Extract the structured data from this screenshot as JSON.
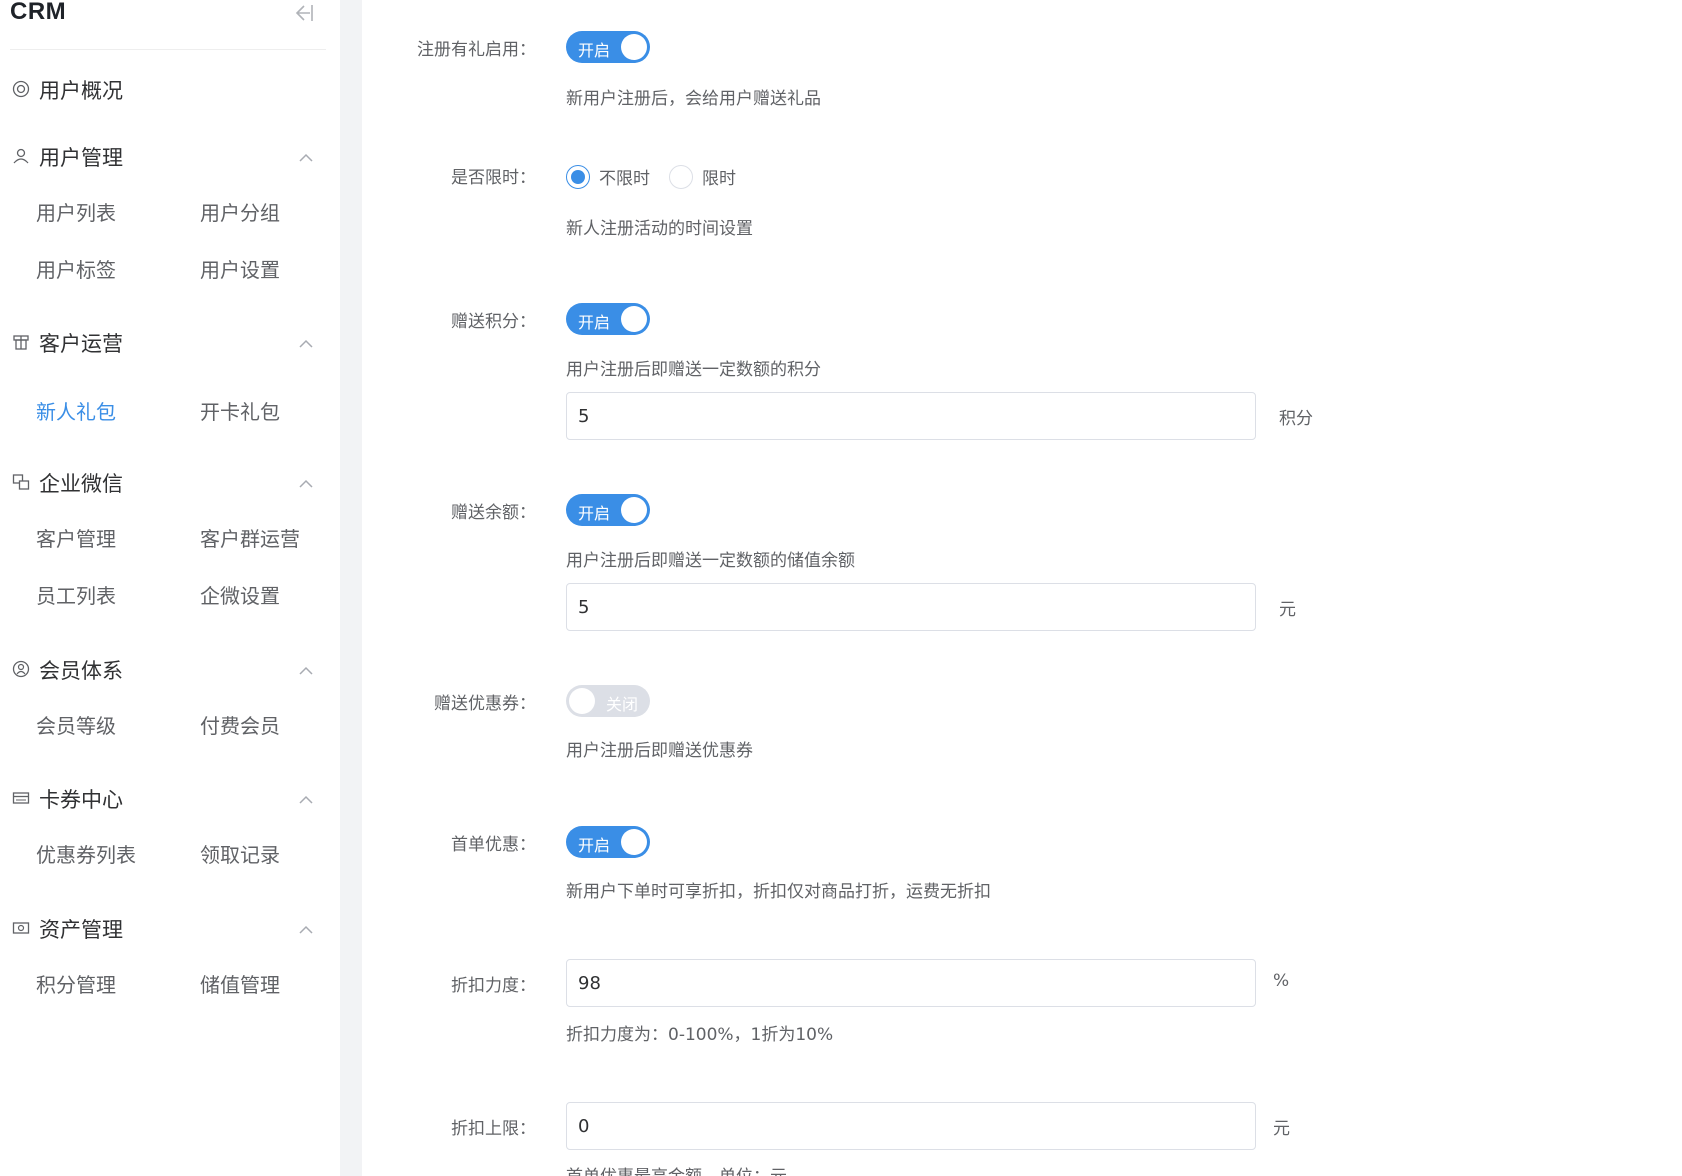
{
  "brand": "CRM",
  "sidebar": {
    "overview": {
      "title": "用户概况"
    },
    "groups": [
      {
        "title": "用户管理",
        "items": [
          "用户列表",
          "用户分组",
          "用户标签",
          "用户设置"
        ]
      },
      {
        "title": "客户运营",
        "items": [
          "新人礼包",
          "开卡礼包"
        ],
        "active": "新人礼包"
      },
      {
        "title": "企业微信",
        "items": [
          "客户管理",
          "客户群运营",
          "员工列表",
          "企微设置"
        ]
      },
      {
        "title": "会员体系",
        "items": [
          "会员等级",
          "付费会员"
        ]
      },
      {
        "title": "卡券中心",
        "items": [
          "优惠券列表",
          "领取记录"
        ]
      },
      {
        "title": "资产管理",
        "items": [
          "积分管理",
          "储值管理"
        ]
      }
    ]
  },
  "form": {
    "register_gift": {
      "label": "注册有礼启用：",
      "switch": "开启",
      "help": "新用户注册后，会给用户赠送礼品"
    },
    "time_limit": {
      "label": "是否限时：",
      "options": [
        "不限时",
        "限时"
      ],
      "selected": "不限时",
      "help": "新人注册活动的时间设置"
    },
    "points": {
      "label": "赠送积分：",
      "switch": "开启",
      "help": "用户注册后即赠送一定数额的积分",
      "value": "5",
      "unit": "积分"
    },
    "balance": {
      "label": "赠送余额：",
      "switch": "开启",
      "help": "用户注册后即赠送一定数额的储值余额",
      "value": "5",
      "unit": "元"
    },
    "coupon": {
      "label": "赠送优惠券：",
      "switch": "关闭",
      "help": "用户注册后即赠送优惠券"
    },
    "first_order": {
      "label": "首单优惠：",
      "switch": "开启",
      "help": "新用户下单时可享折扣，折扣仅对商品打折，运费无折扣"
    },
    "discount": {
      "label": "折扣力度：",
      "value": "98",
      "unit": "%",
      "help": "折扣力度为：0-100%，1折为10%"
    },
    "discount_cap": {
      "label": "折扣上限：",
      "value": "0",
      "unit": "元",
      "help": "首单优惠最高金额，单位：元"
    }
  }
}
